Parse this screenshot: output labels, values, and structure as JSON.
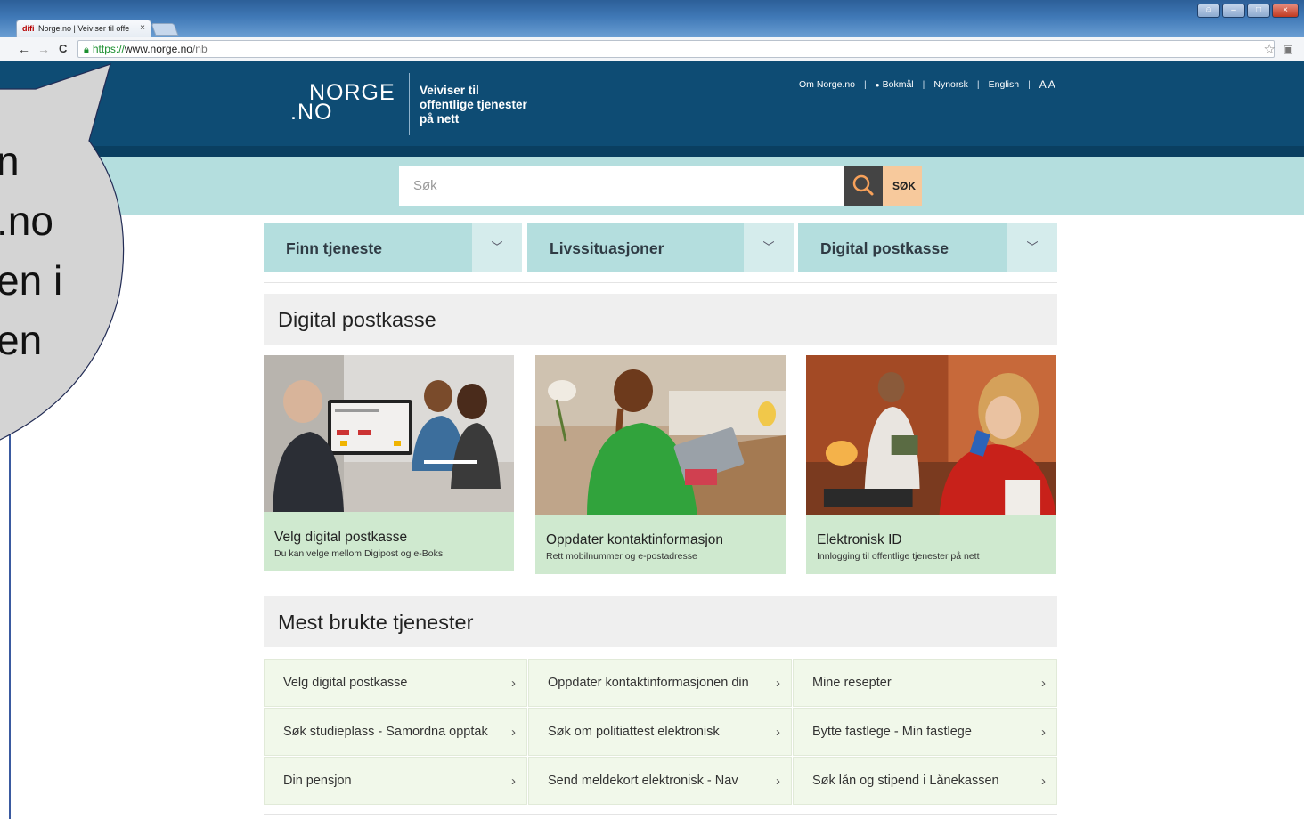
{
  "browser": {
    "tab_favicon_text": "difi",
    "tab_title": "Norge.no | Veiviser til offe",
    "tab_close": "×",
    "nav_back": "←",
    "nav_forward": "→",
    "nav_reload": "C",
    "url_scheme": "https://",
    "url_host": "www.norge.no",
    "url_path": "/nb"
  },
  "header": {
    "logo_line1": "NORGE",
    "logo_line2": ".NO",
    "tagline_1": "Veiviser til",
    "tagline_2": "offentlige tjenester",
    "tagline_3": "på nett",
    "links": {
      "about": "Om Norge.no",
      "bokmal": "Bokmål",
      "nynorsk": "Nynorsk",
      "english": "English",
      "text_size": "A A"
    }
  },
  "search": {
    "placeholder": "Søk",
    "button_label": "SØK"
  },
  "main_nav": [
    {
      "label": "Finn tjeneste"
    },
    {
      "label": "Livssituasjoner"
    },
    {
      "label": "Digital postkasse"
    }
  ],
  "digital_postkasse": {
    "heading": "Digital postkasse",
    "cards": [
      {
        "title": "Velg digital postkasse",
        "subtitle": "Du kan velge mellom Digipost og e-Boks"
      },
      {
        "title": "Oppdater kontaktinformasjon",
        "subtitle": "Rett mobilnummer og e-postadresse"
      },
      {
        "title": "Elektronisk ID",
        "subtitle": "Innlogging til offentlige tjenester på nett"
      }
    ]
  },
  "mest_brukte": {
    "heading": "Mest brukte tjenester",
    "services": [
      "Velg digital postkasse",
      "Oppdater kontaktinformasjonen din",
      "Mine resepter",
      "Søk studieplass - Samordna opptak",
      "Søk om politiattest elektronisk",
      "Bytte fastlege - Min fastlege",
      "Din pensjon",
      "Send meldekort elektronisk - Nav",
      "Søk lån og stipend i Lånekassen"
    ]
  },
  "overlay": {
    "bubble_lines": [
      "n",
      ".no",
      "en i",
      "en"
    ]
  },
  "colors": {
    "header_bg": "#0e4c74",
    "search_band": "#b4dede",
    "card_caption": "#cfe9cf",
    "service_bg": "#f1f8ea",
    "search_button": "#f7c99c"
  },
  "icons": [
    "search-icon",
    "chevron-down-icon",
    "chevron-right-icon",
    "lock-icon",
    "star-icon",
    "close-icon"
  ]
}
